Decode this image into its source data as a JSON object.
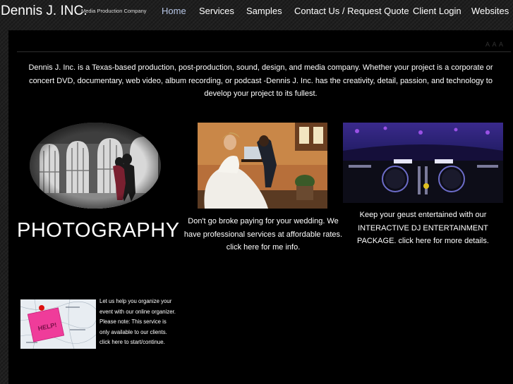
{
  "header": {
    "brand": "Dennis J. INC.",
    "tagline": "Media Production Company",
    "nav": [
      {
        "label": "Home",
        "active": true
      },
      {
        "label": "Services"
      },
      {
        "label": "Samples"
      },
      {
        "label": "Contact Us / Request Quote"
      },
      {
        "label": "Client Login"
      },
      {
        "label": "Websites"
      }
    ]
  },
  "panel": {
    "text_size_control": "A A A",
    "intro": "Dennis J. Inc. is a Texas-based production, post-production, sound, design, and media company. Whether your project is a corporate or concert DVD, documentary, web video, album recording, or podcast -Dennis J. Inc.  has the creativity, detail, passion, and technology to develop your project to its fullest."
  },
  "features": {
    "photography": {
      "title": "PHOTOGRAPHY"
    },
    "wedding": {
      "caption": "Don't go broke paying for your wedding. We have professional services at affordable rates.",
      "link": "click here for me info."
    },
    "dj": {
      "caption": "Keep your geust entertained with our INTERACTIVE DJ ENTERTAINMENT PACKAGE.",
      "link": "click here for more details."
    },
    "organizer": {
      "caption": "Let us help you organize your event with our online organizer. Please note: This service is only available to our clients.",
      "link": "click here to start/continue.",
      "note_text": "HELP!"
    }
  },
  "colors": {
    "background": "#000000",
    "nav_active": "#b7c6e6",
    "text": "#ffffff"
  }
}
